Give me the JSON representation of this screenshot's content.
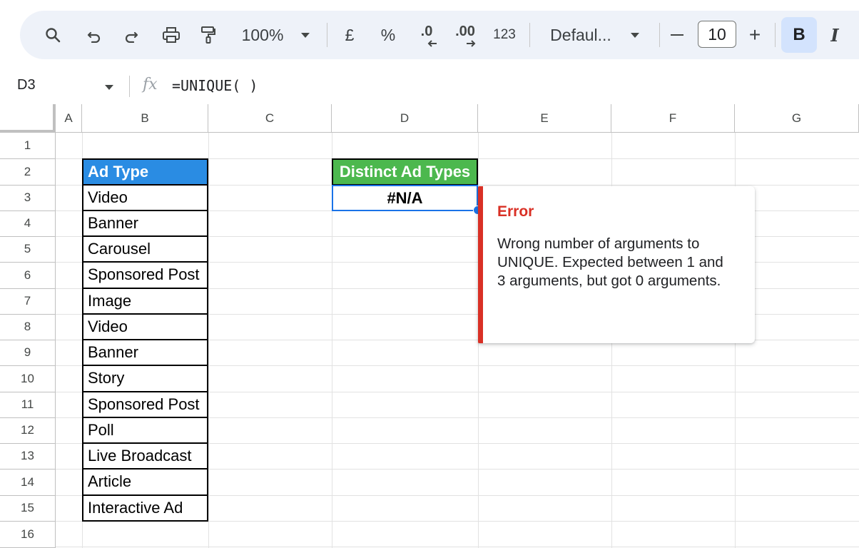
{
  "toolbar": {
    "zoom": "100%",
    "currency": "£",
    "percent": "%",
    "decrease_decimal": ".0",
    "increase_decimal": ".00",
    "number_format": "123",
    "font_name": "Defaul...",
    "font_size": "10",
    "minus": "—",
    "plus": "+",
    "bold": "B",
    "italic": "I"
  },
  "formula_bar": {
    "cell_ref": "D3",
    "fx": "fx",
    "formula": "=UNIQUE( )"
  },
  "columns": [
    "A",
    "B",
    "C",
    "D",
    "E",
    "F",
    "G"
  ],
  "rows": [
    "1",
    "2",
    "3",
    "4",
    "5",
    "6",
    "7",
    "8",
    "9",
    "10",
    "11",
    "12",
    "13",
    "14",
    "15",
    "16"
  ],
  "cells": {
    "B2": "Ad Type",
    "B": [
      "Video",
      "Banner",
      "Carousel",
      "Sponsored Post",
      "Image",
      "Video",
      "Banner",
      "Story",
      "Sponsored Post",
      "Poll",
      "Live Broadcast",
      "Article",
      "Interactive Ad"
    ],
    "D2": "Distinct Ad Types",
    "D3": "#N/A"
  },
  "error_popup": {
    "title": "Error",
    "message": "Wrong number of arguments to UNIQUE. Expected between 1 and 3 arguments, but got 0 arguments."
  },
  "colors": {
    "header_blue": "#2a8ce3",
    "header_green": "#4cb84e",
    "error_red": "#d93025",
    "selection_blue": "#1a73e8"
  }
}
